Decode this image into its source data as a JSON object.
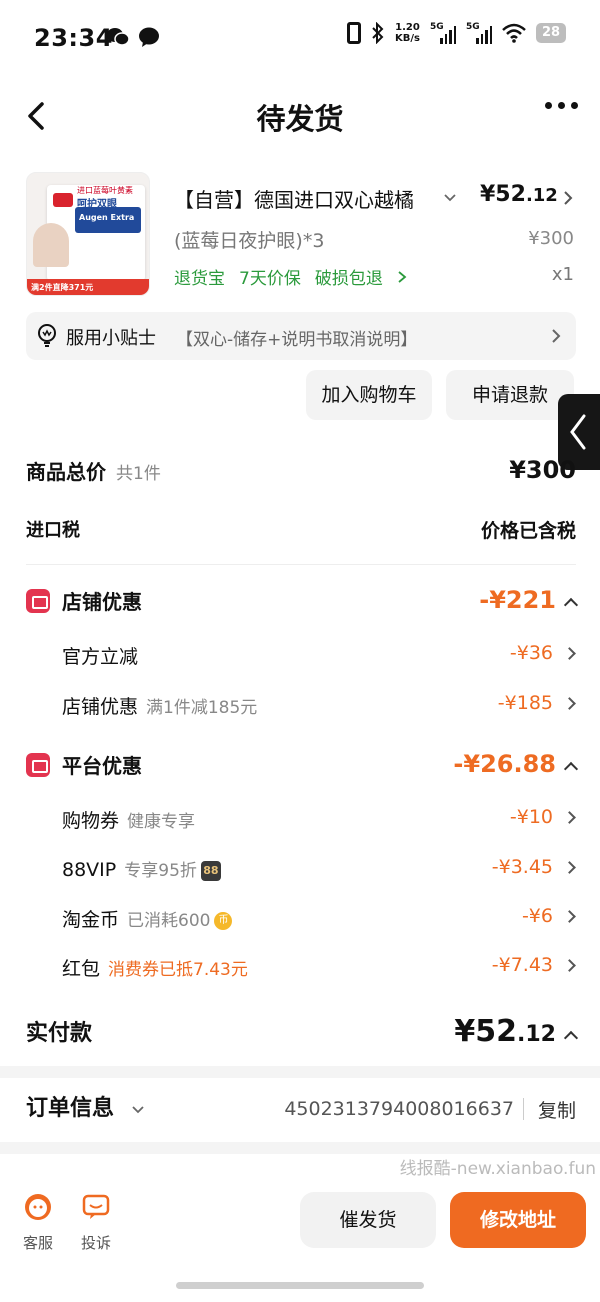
{
  "status_bar": {
    "time": "23:34",
    "net_speed_value": "1.20",
    "net_speed_unit": "KB/s",
    "sim1": "5G",
    "sim2": "5G",
    "battery": "28"
  },
  "nav": {
    "title": "待发货"
  },
  "product": {
    "title": "【自营】德国进口双心越橘",
    "price_int": "¥52",
    "price_dec": ".12",
    "spec": "(蓝莓日夜护眼)*3",
    "original_price": "¥300",
    "services": [
      "退货宝",
      "7天价保",
      "破损包退"
    ],
    "quantity": "x1",
    "image_text": {
      "top": "进口蓝莓叶黄素",
      "headline": "呵护双眼",
      "brand": "Augen Extra",
      "banner": "满2件直降371元"
    }
  },
  "tips": {
    "label": "服用小贴士",
    "text": "【双心-储存+说明书取消说明】"
  },
  "actions": {
    "add_to_cart": "加入购物车",
    "refund": "申请退款"
  },
  "summary": {
    "total_label": "商品总价",
    "total_count": "共1件",
    "total_value": "¥300",
    "tax_label": "进口税",
    "tax_value": "价格已含税"
  },
  "shop_discount": {
    "label": "店铺优惠",
    "total": "-¥221",
    "items": [
      {
        "label": "官方立减",
        "note": "",
        "amount": "-¥36"
      },
      {
        "label": "店铺优惠",
        "note": "满1件减185元",
        "amount": "-¥185"
      }
    ]
  },
  "platform_discount": {
    "label": "平台优惠",
    "total": "-¥26.88",
    "items": [
      {
        "label": "购物券",
        "note": "健康专享",
        "amount": "-¥10"
      },
      {
        "label": "88VIP",
        "note": "专享95折",
        "badge": "88",
        "amount": "-¥3.45"
      },
      {
        "label": "淘金币",
        "note": "已消耗600",
        "badge": "币",
        "amount": "-¥6"
      },
      {
        "label": "红包",
        "note": "消费券已抵7.43元",
        "amount": "-¥7.43"
      }
    ]
  },
  "paid": {
    "label": "实付款",
    "value_int": "¥52",
    "value_dec": ".12"
  },
  "order": {
    "label": "订单信息",
    "number": "4502313794008016637",
    "copy": "复制"
  },
  "watermark": "线报酷-new.xianbao.fun",
  "bottom_bar": {
    "service": "客服",
    "complaint": "投诉",
    "urge": "催发货",
    "modify_address": "修改地址"
  },
  "colors": {
    "accent": "#ef6a21",
    "discount": "#ee6b22",
    "green_service": "#2b9a3c",
    "section_icon": "#e3344f"
  }
}
